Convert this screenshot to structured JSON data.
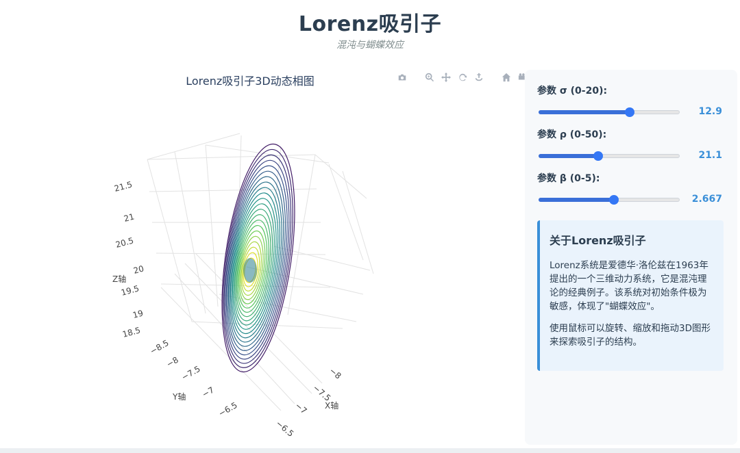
{
  "header": {
    "title": "Lorenz吸引子",
    "subtitle": "混沌与蝴蝶效应"
  },
  "plot": {
    "title": "Lorenz吸引子3D动态相图",
    "modebar": [
      "camera-icon",
      "zoom-icon",
      "pan-icon",
      "orbit-rotate-icon",
      "turntable-icon",
      "home-icon",
      "video-camera-icon"
    ],
    "axes": {
      "z_label": "Z轴",
      "y_label": "Y轴",
      "x_label": "X轴",
      "z_ticks": [
        "21.5",
        "21",
        "20.5",
        "20",
        "19.5",
        "19",
        "18.5"
      ],
      "y_ticks": [
        "−8.5",
        "−8",
        "−7.5",
        "−7",
        "−6.5"
      ],
      "x_ticks": [
        "−8",
        "−7.5",
        "−7",
        "−6.5"
      ]
    },
    "colorscale": [
      "#440154",
      "#3b528b",
      "#21918c",
      "#5ec962",
      "#fde725"
    ]
  },
  "controls": {
    "sigma": {
      "label": "参数 σ (0-20):",
      "value": "12.9",
      "min": 0,
      "max": 20,
      "num": 12.9
    },
    "rho": {
      "label": "参数 ρ (0-50):",
      "value": "21.1",
      "min": 0,
      "max": 50,
      "num": 21.1
    },
    "beta": {
      "label": "参数 β (0-5):",
      "value": "2.667",
      "min": 0,
      "max": 5,
      "num": 2.667
    }
  },
  "info": {
    "title": "关于Lorenz吸引子",
    "p1": "Lorenz系统是爱德华·洛伦兹在1963年提出的一个三维动力系统，它是混沌理论的经典例子。该系统对初始条件极为敏感，体现了\"蝴蝶效应\"。",
    "p2": "使用鼠标可以旋转、缩放和拖动3D图形来探索吸引子的结构。"
  }
}
